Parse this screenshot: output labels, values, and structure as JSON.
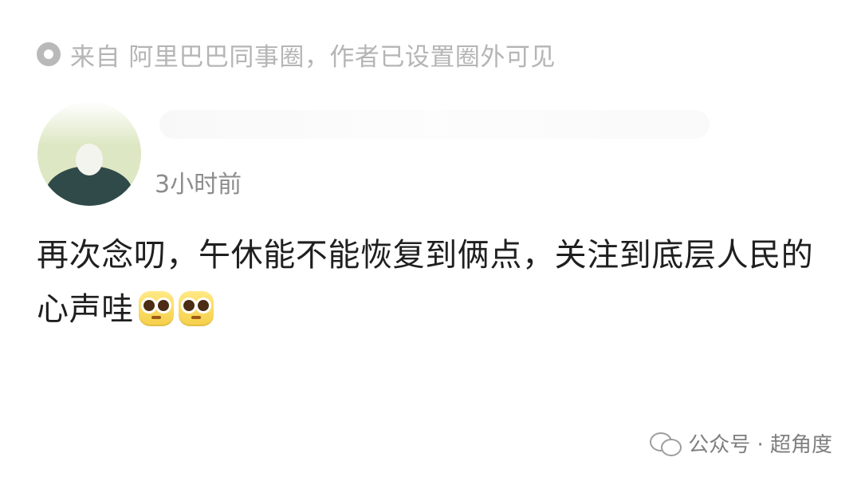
{
  "source": {
    "icon": "source-icon",
    "text": "来自 阿里巴巴同事圈，作者已设置圈外可见"
  },
  "post": {
    "timestamp": "3小时前",
    "body_text": "再次念叨，午休能不能恢复到俩点，关注到底层人民的心声哇",
    "emoji_count": 2
  },
  "watermark": {
    "icon": "wechat-icon",
    "text": "公众号 · 超角度"
  }
}
